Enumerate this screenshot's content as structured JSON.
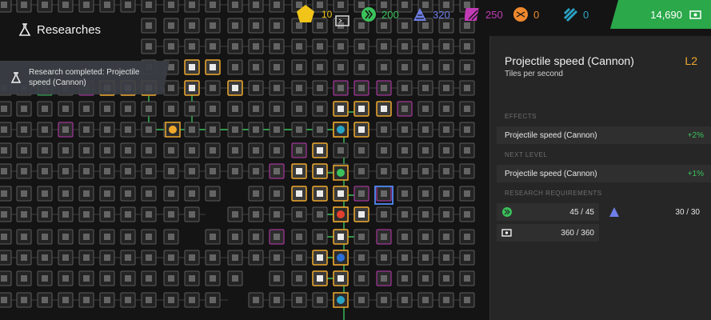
{
  "title": "Researches",
  "toast": {
    "text_line1": "Research completed: Projectile",
    "text_line2": "speed (Cannon)"
  },
  "level_badge": "10",
  "resources": [
    {
      "name": "green-resource",
      "value": "200",
      "color": "#3bc25b"
    },
    {
      "name": "blue-resource",
      "value": "320",
      "color": "#6f7fe8"
    },
    {
      "name": "purple-resource",
      "value": "250",
      "color": "#c23bb6"
    },
    {
      "name": "orange-resource",
      "value": "0",
      "color": "#f0892d"
    },
    {
      "name": "cyan-resource",
      "value": "0",
      "color": "#2aa3c4"
    }
  ],
  "money": "14,690",
  "panel": {
    "title": "Projectile speed (Cannon)",
    "subtitle": "Tiles per second",
    "level": "L2",
    "effects_heading": "EFFECTS",
    "effect": {
      "label": "Projectile speed (Cannon)",
      "value": "+2%"
    },
    "next_heading": "NEXT LEVEL",
    "next": {
      "label": "Projectile speed (Cannon)",
      "value": "+1%"
    },
    "req_heading": "RESEARCH REQUIREMENTS",
    "requirements": [
      {
        "icon": "green-resource",
        "value": "45 / 45"
      },
      {
        "icon": "blue-resource",
        "value": "30 / 30"
      },
      {
        "icon": "money",
        "value": "360 / 360"
      }
    ]
  },
  "colors": {
    "researched": "#f0a92d",
    "locked": "#8a8a8a",
    "line": "#3bc25b",
    "purple": "#c23bb6",
    "bg": "#141414",
    "panel": "#262626"
  }
}
